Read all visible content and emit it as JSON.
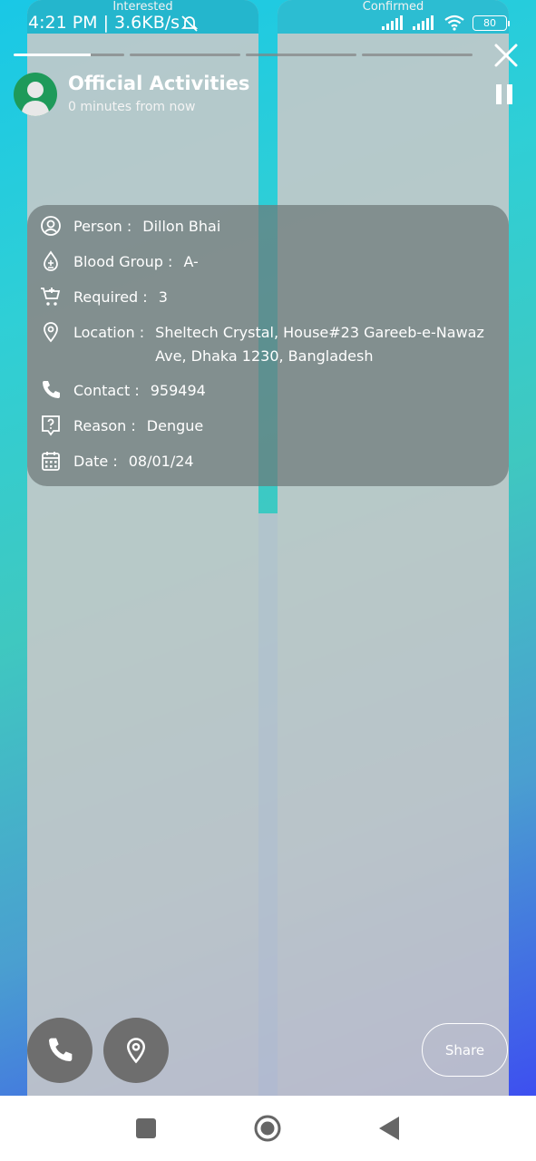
{
  "status_bar": {
    "time": "4:21 PM | 3.6KB/s",
    "battery": "80"
  },
  "tabs": {
    "left": "Interested",
    "right": "Confirmed"
  },
  "story": {
    "title": "Official Activities",
    "subtitle": "0 minutes from now",
    "progress": [
      1,
      0,
      0,
      0
    ],
    "current_segment_progress": 0.7
  },
  "details": {
    "person_label": "Person :",
    "person_value": "Dillon Bhai",
    "blood_label": "Blood Group :",
    "blood_value": "A-",
    "required_label": "Required :",
    "required_value": "3",
    "location_label": "Location :",
    "location_value": "Sheltech Crystal, House#23 Gareeb-e-Nawaz Ave, Dhaka 1230, Bangladesh",
    "contact_label": "Contact :",
    "contact_value": "959494",
    "reason_label": "Reason :",
    "reason_value": "Dengue",
    "date_label": "Date :",
    "date_value": "08/01/24"
  },
  "actions": {
    "share_label": "Share"
  },
  "colors": {
    "card_bg": "#6e7878",
    "fab_bg": "#6e6e6e",
    "accent": "#1e9a5a"
  }
}
